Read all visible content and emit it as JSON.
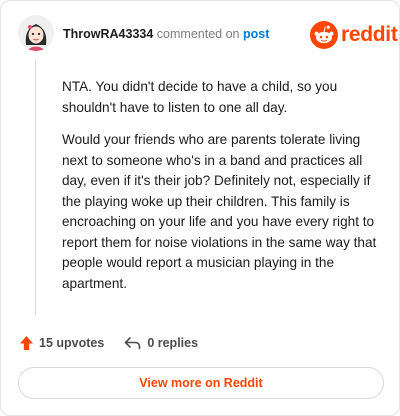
{
  "comment": {
    "username": "ThrowRA43334",
    "commented_text": "commented on",
    "post_link_text": "post",
    "paragraphs": [
      "NTA. You didn't decide to have a child, so you shouldn't have to listen to one all day.",
      "Would your friends who are parents tolerate living next to someone who's in a band and practices all day, even if it's their job? Definitely not, especially if the playing woke up their children. This family is encroaching on your life and you have every right to report them for noise violations in the same way that people would report a musician playing in the apartment."
    ]
  },
  "brand": {
    "wordmark": "reddit",
    "color": "#ff4500",
    "icon": "reddit-snoo-icon"
  },
  "actions": {
    "upvotes_label": "15 upvotes",
    "replies_label": "0 replies",
    "upvote_icon": "upvote-arrow-icon",
    "reply_icon": "reply-arrow-icon",
    "upvote_color": "#ff4500"
  },
  "footer": {
    "view_more_label": "View more on Reddit"
  },
  "colors": {
    "accent": "#ff4500",
    "link": "#0079d3",
    "text": "#1c1c1c",
    "muted": "#7c7c7c"
  }
}
